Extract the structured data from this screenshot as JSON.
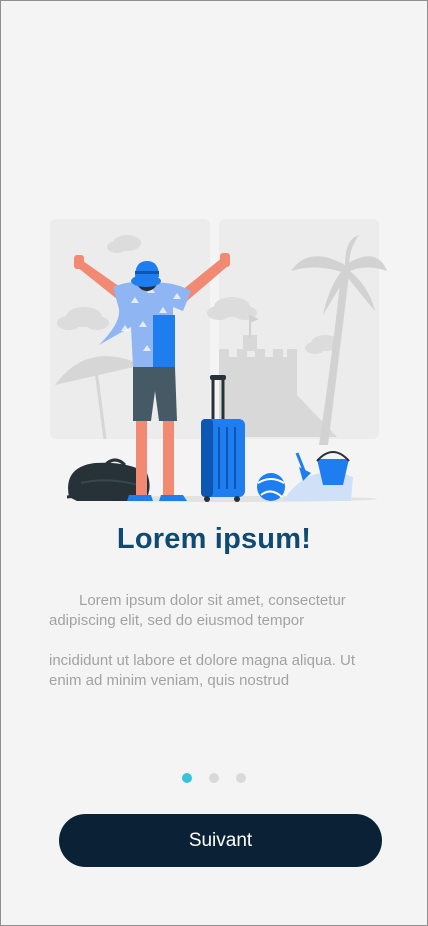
{
  "onboarding": {
    "title": "Lorem ipsum!",
    "paragraph_1": "Lorem ipsum dolor sit amet, consectetur adipiscing elit, sed do eiusmod tempor",
    "paragraph_2": "incididunt ut labore et dolore magna aliqua. Ut enim ad minim veniam, quis nostrud",
    "page_count": 3,
    "active_page": 1,
    "next_button_label": "Suivant"
  },
  "colors": {
    "background": "#f4f4f4",
    "title": "#0e4a72",
    "body_text": "#a2a2a2",
    "dot_active": "#37c3d9",
    "dot_inactive": "#d9d9d9",
    "button_background": "#0b2236",
    "button_text": "#ffffff",
    "illustration_accent": "#1e7ef0"
  },
  "illustration": {
    "icon": "traveler-beach-illustration"
  }
}
